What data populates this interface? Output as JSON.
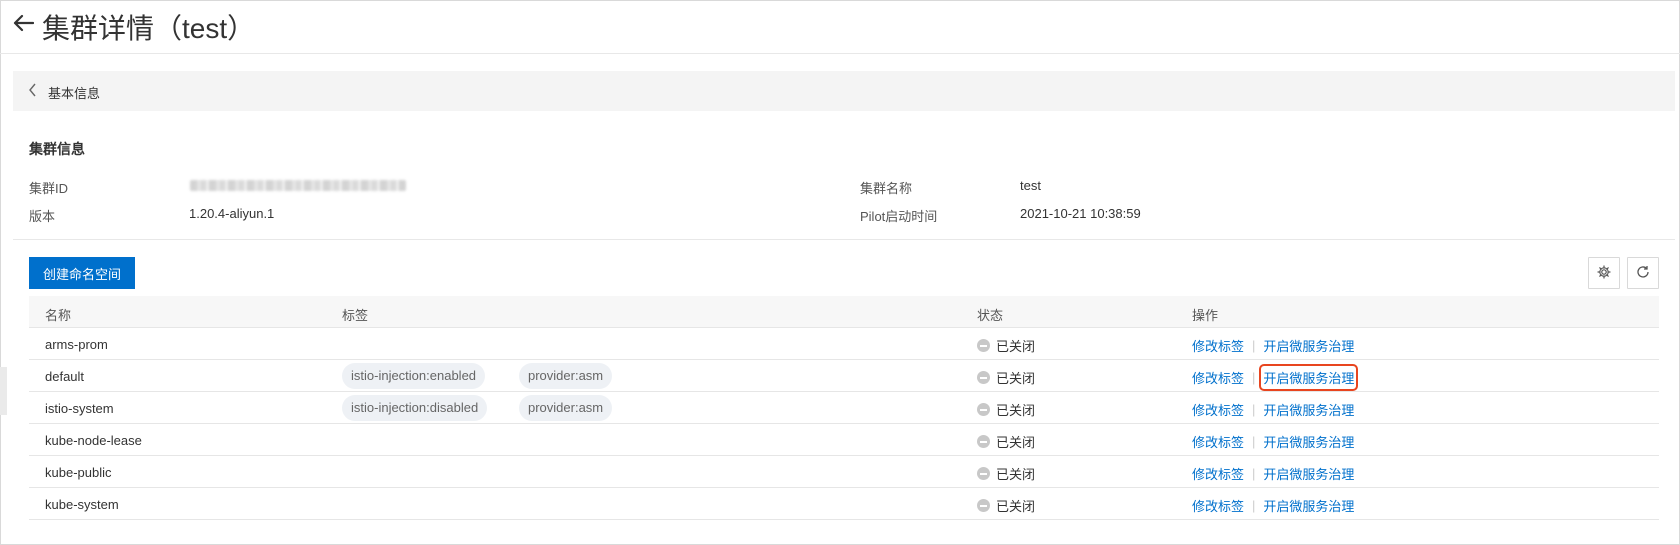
{
  "header": {
    "title": "集群详情（test）"
  },
  "section": {
    "label": "基本信息"
  },
  "cluster_info": {
    "title": "集群信息",
    "id_label": "集群ID",
    "version_label": "版本",
    "version_value": "1.20.4-aliyun.1",
    "name_label": "集群名称",
    "name_value": "test",
    "pilot_label": "Pilot启动时间",
    "pilot_value": "2021-10-21 10:38:59"
  },
  "toolbar": {
    "create_label": "创建命名空间",
    "settings_icon": "gear-icon",
    "refresh_icon": "refresh-icon"
  },
  "table": {
    "columns": [
      "名称",
      "标签",
      "状态",
      "操作"
    ],
    "rows": [
      {
        "name": "arms-prom",
        "tags": [],
        "status": "已关闭",
        "action1": "修改标签",
        "action2": "开启微服务治理"
      },
      {
        "name": "default",
        "tags": [
          "istio-injection:enabled",
          "provider:asm"
        ],
        "status": "已关闭",
        "action1": "修改标签",
        "action2": "开启微服务治理"
      },
      {
        "name": "istio-system",
        "tags": [
          "istio-injection:disabled",
          "provider:asm"
        ],
        "status": "已关闭",
        "action1": "修改标签",
        "action2": "开启微服务治理"
      },
      {
        "name": "kube-node-lease",
        "tags": [],
        "status": "已关闭",
        "action1": "修改标签",
        "action2": "开启微服务治理"
      },
      {
        "name": "kube-public",
        "tags": [],
        "status": "已关闭",
        "action1": "修改标签",
        "action2": "开启微服务治理"
      },
      {
        "name": "kube-system",
        "tags": [],
        "status": "已关闭",
        "action1": "修改标签",
        "action2": "开启微服务治理"
      }
    ]
  },
  "colors": {
    "primary": "#0070cc",
    "highlight": "#e8451f"
  }
}
